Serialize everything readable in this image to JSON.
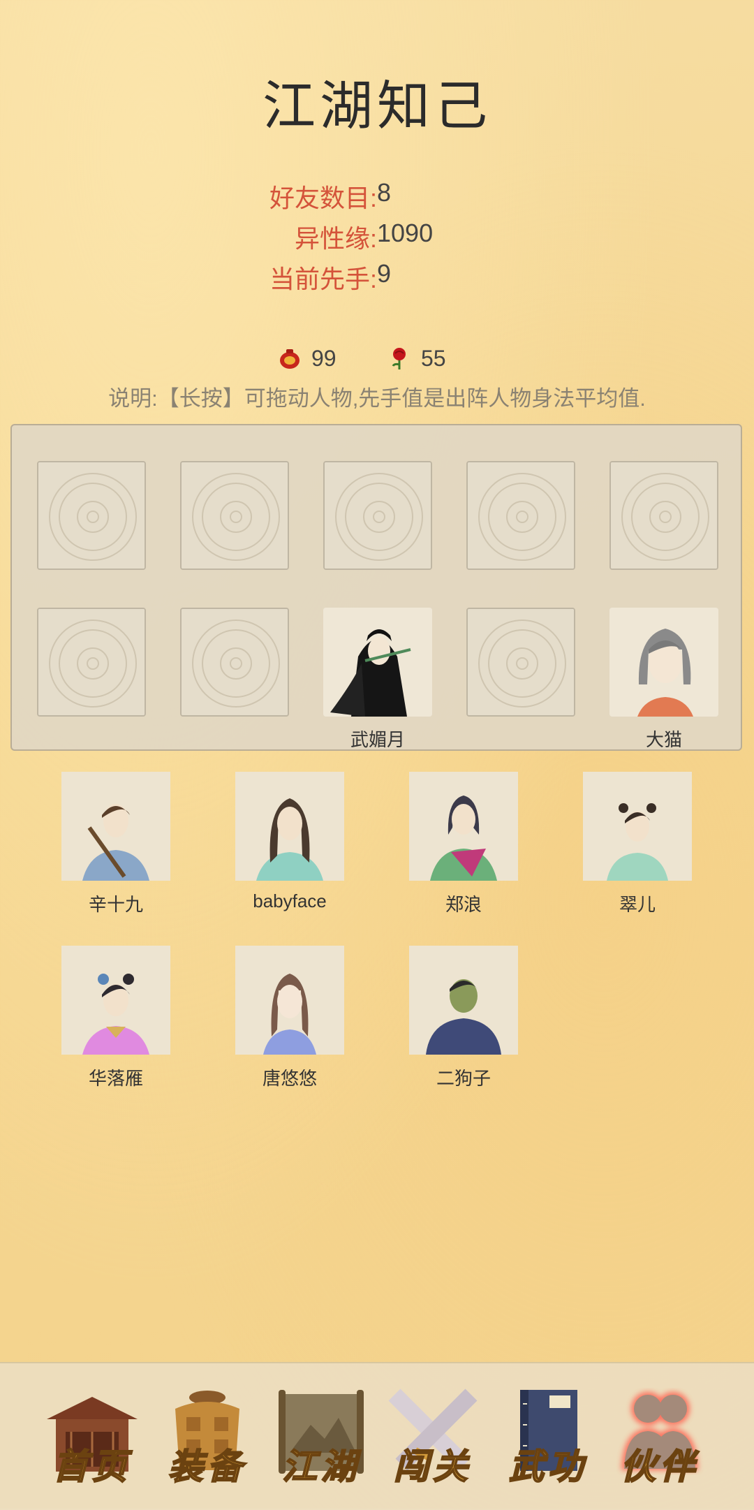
{
  "title": "江湖知己",
  "stats": [
    {
      "label": "好友数目:",
      "value": "8"
    },
    {
      "label": "异性缘:",
      "value": "1090"
    },
    {
      "label": "当前先手:",
      "value": "9"
    }
  ],
  "resources": [
    {
      "icon": "red-pouch-icon",
      "value": "99"
    },
    {
      "icon": "rose-icon",
      "value": "55"
    }
  ],
  "hint": "说明:【长按】可拖动人物,先手值是出阵人物身法平均值.",
  "team_slots": [
    {
      "filled": false,
      "name": ""
    },
    {
      "filled": false,
      "name": ""
    },
    {
      "filled": false,
      "name": ""
    },
    {
      "filled": false,
      "name": ""
    },
    {
      "filled": false,
      "name": ""
    },
    {
      "filled": false,
      "name": ""
    },
    {
      "filled": false,
      "name": ""
    },
    {
      "filled": true,
      "name": "武媚月"
    },
    {
      "filled": false,
      "name": ""
    },
    {
      "filled": true,
      "name": "大猫"
    }
  ],
  "friends": [
    {
      "name": "辛十九",
      "color": "#8aa7c8"
    },
    {
      "name": "babyface",
      "color": "#8fd0c2"
    },
    {
      "name": "郑浪",
      "color": "#6bb07a"
    },
    {
      "name": "翠儿",
      "color": "#9fd6bf"
    },
    {
      "name": "华落雁",
      "color": "#e08ae0"
    },
    {
      "name": "唐悠悠",
      "color": "#8e9ee0"
    },
    {
      "name": "二狗子",
      "color": "#3f4a78"
    }
  ],
  "nav": [
    {
      "label": "首页",
      "icon": "house-icon"
    },
    {
      "label": "装备",
      "icon": "armor-icon"
    },
    {
      "label": "江湖",
      "icon": "scroll-map-icon"
    },
    {
      "label": "闯关",
      "icon": "crossed-swords-icon"
    },
    {
      "label": "武功",
      "icon": "book-icon"
    },
    {
      "label": "伙伴",
      "icon": "partners-icon"
    }
  ],
  "colors": {
    "accent": "#d4533a",
    "nav_text": "#e2a93a",
    "active_glow": "#e35a4a"
  }
}
